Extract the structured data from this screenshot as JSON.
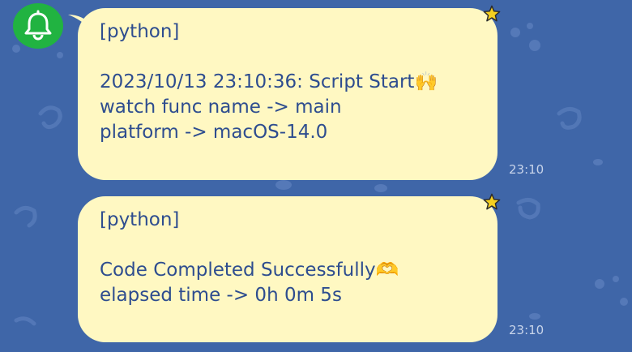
{
  "messages": [
    {
      "lines": [
        "[python]",
        "",
        "2023/10/13 23:10:36: Script Start🙌",
        "watch func name -> main",
        "platform -> macOS-14.0"
      ],
      "time": "23:10"
    },
    {
      "lines": [
        "[python]",
        "",
        "Code Completed Successfully🫶",
        "elapsed time -> 0h 0m 5s"
      ],
      "time": "23:10"
    }
  ],
  "colors": {
    "background": "#3f66a8",
    "bubble": "#fff8c2",
    "text": "#2e4d8f",
    "avatar": "#21b341",
    "star": "#f5d020"
  },
  "icons": [
    "bell-icon",
    "star-icon"
  ]
}
